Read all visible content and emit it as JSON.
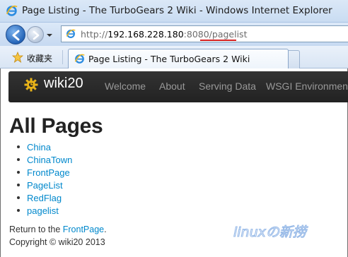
{
  "window": {
    "title": "Page Listing - The TurboGears 2 Wiki - Windows Internet Explorer"
  },
  "address_bar": {
    "url_protocol": "http://",
    "url_host": "192.168.228.180",
    "url_port_path": ":8080/pagelist"
  },
  "favorites": {
    "label": "收藏夹"
  },
  "tab": {
    "label": "Page Listing - The TurboGears 2 Wiki"
  },
  "site": {
    "brand": "wiki20",
    "nav": [
      "Welcome",
      "About",
      "Serving Data",
      "WSGI Environment"
    ]
  },
  "content": {
    "title": "All Pages",
    "pages": [
      "China",
      "ChinaTown",
      "FrontPage",
      "PageList",
      "RedFlag",
      "pagelist"
    ],
    "return_prefix": "Return to the ",
    "return_link": "FrontPage",
    "return_suffix": ".",
    "copyright": "Copyright © wiki20 2013"
  },
  "watermark": {
    "text": "linuxの新捞"
  },
  "colors": {
    "link": "#0088cc",
    "navbar": "#222222",
    "nav_text": "#999999",
    "ie_chrome": "#dbe8f7"
  }
}
